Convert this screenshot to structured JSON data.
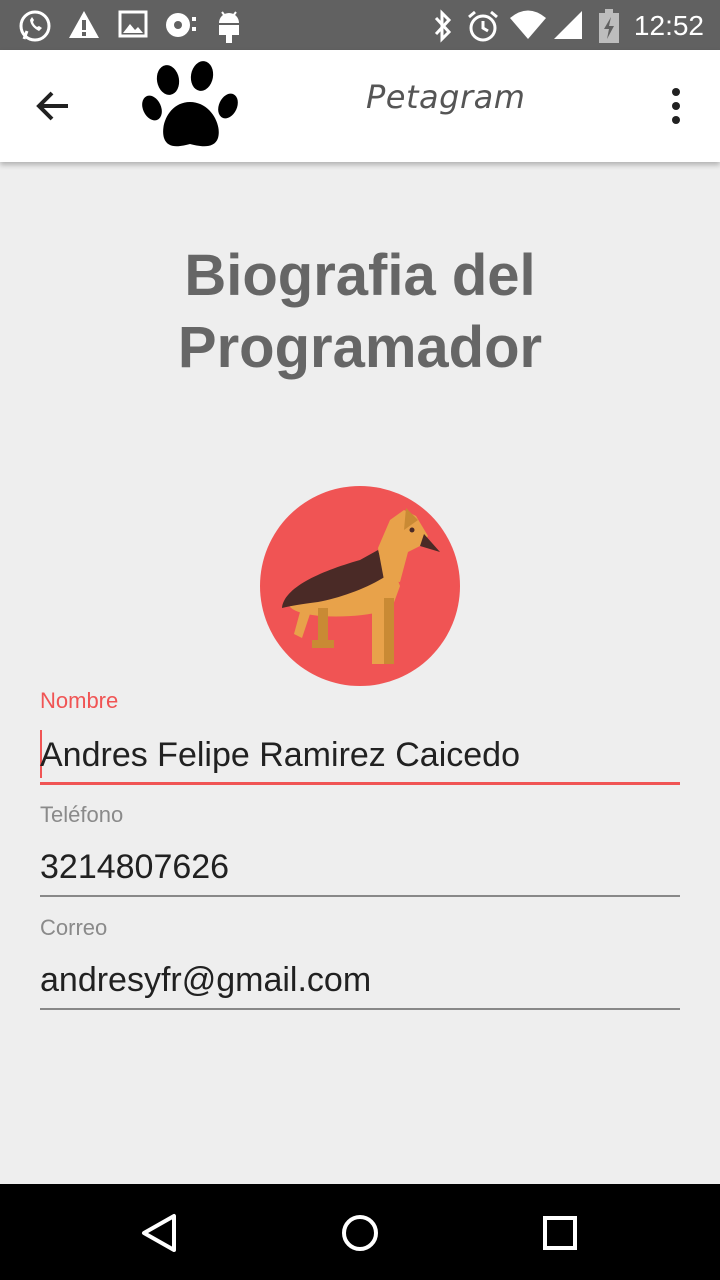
{
  "status_bar": {
    "time": "12:52",
    "left_icons": [
      "whatsapp-icon",
      "warning-icon",
      "image-icon",
      "media-icon",
      "android-icon"
    ],
    "right_icons": [
      "bluetooth-icon",
      "alarm-icon",
      "wifi-icon",
      "signal-icon",
      "battery-charging-icon"
    ]
  },
  "app_bar": {
    "title": "Petagram",
    "logo_icon": "paw-icon",
    "back_icon": "arrow-back-icon",
    "menu_icon": "more-vert-icon"
  },
  "page": {
    "title_line1": "Biografia del",
    "title_line2": "Programador",
    "avatar_icon": "dog-icon"
  },
  "form": {
    "nombre": {
      "label": "Nombre",
      "value": "Andres Felipe Ramirez Caicedo"
    },
    "telefono": {
      "label": "Teléfono",
      "value": "3214807626"
    },
    "correo": {
      "label": "Correo",
      "value": "andresyfr@gmail.com"
    }
  },
  "nav_bar": {
    "back_icon": "nav-back-icon",
    "home_icon": "nav-home-icon",
    "recents_icon": "nav-recents-icon"
  },
  "colors": {
    "accent": "#f05454",
    "status_bar": "#616161",
    "background": "#eeeeee"
  }
}
